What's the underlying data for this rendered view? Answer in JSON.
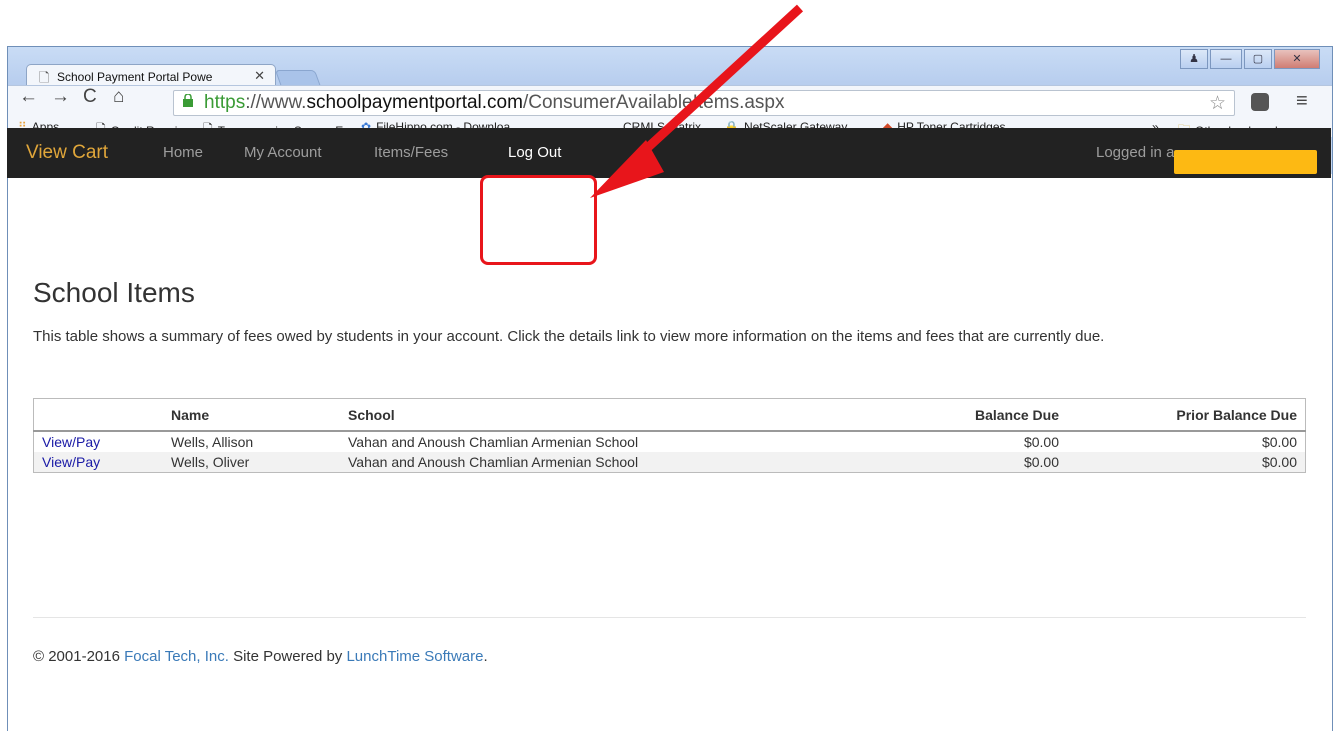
{
  "browser": {
    "tab_title": "School Payment Portal Powe",
    "url": {
      "protocol": "https",
      "rest_prefix": "://www.",
      "host": "schoolpaymentportal.com",
      "path": "/ConsumerAvailableItems.aspx"
    },
    "bookmarks": [
      {
        "label": "Apps",
        "icon": "apps-icon"
      },
      {
        "label": "Credit Repair",
        "icon": "page-icon"
      },
      {
        "label": "Transamerica Secure Em",
        "icon": "page-icon"
      },
      {
        "label": "FileHippo.com - Downloa",
        "icon": "filehippo-icon"
      },
      {
        "label": "CRMLS Matrix",
        "icon": "crmls-icon"
      },
      {
        "label": "NetScaler Gateway",
        "icon": "lock-icon"
      },
      {
        "label": "HP Toner Cartridges",
        "icon": "hp-icon"
      }
    ],
    "overflow": "»",
    "other_bookmarks": "Other bookmarks"
  },
  "navbar": {
    "brand": "View Cart",
    "links": [
      "Home",
      "My Account",
      "Items/Fees",
      "Log Out"
    ],
    "active": "Log Out",
    "logged_in_text": "Logged in a"
  },
  "page": {
    "title": "School Items",
    "description": "This table shows a summary of fees owed by students in your account. Click the details link to view more information on the items and fees that are currently due."
  },
  "table": {
    "headers": [
      "",
      "Name",
      "School",
      "Balance Due",
      "Prior Balance Due"
    ],
    "rows": [
      {
        "action": "View/Pay",
        "name": "Wells, Allison",
        "school": "Vahan and Anoush Chamlian Armenian School",
        "balance": "$0.00",
        "prior": "$0.00"
      },
      {
        "action": "View/Pay",
        "name": "Wells, Oliver",
        "school": "Vahan and Anoush Chamlian Armenian School",
        "balance": "$0.00",
        "prior": "$0.00"
      }
    ]
  },
  "footer": {
    "copyright": "© 2001-2016 ",
    "company": "Focal Tech, Inc.",
    "middle": " Site Powered by ",
    "software": "LunchTime Software",
    "end": "."
  },
  "colors": {
    "brand": "#e0a63a",
    "annotation": "#e8151b",
    "redaction": "#fdb913",
    "navbar_bg": "#222222"
  }
}
